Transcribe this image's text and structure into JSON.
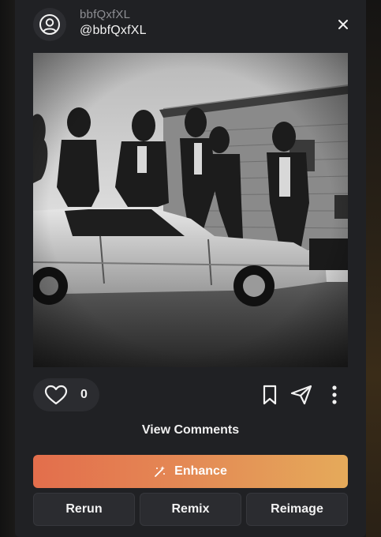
{
  "header": {
    "display_name": "bbfQxfXL",
    "handle": "@bbfQxfXL"
  },
  "image": {
    "alt": ""
  },
  "actions": {
    "like_count": "0",
    "view_comments": "View Comments"
  },
  "buttons": {
    "enhance": "Enhance",
    "rerun": "Rerun",
    "remix": "Remix",
    "reimage": "Reimage"
  },
  "icons": {
    "avatar": "user-circle-icon",
    "close": "close-icon",
    "like": "heart-icon",
    "bookmark": "bookmark-icon",
    "share": "send-icon",
    "more": "more-vertical-icon",
    "enhance": "magic-wand-icon"
  },
  "colors": {
    "card_background": "#202124",
    "pill_background": "#2b2c30",
    "enhance_gradient_start": "#e36e4c",
    "enhance_gradient_end": "#e5aa5a"
  }
}
